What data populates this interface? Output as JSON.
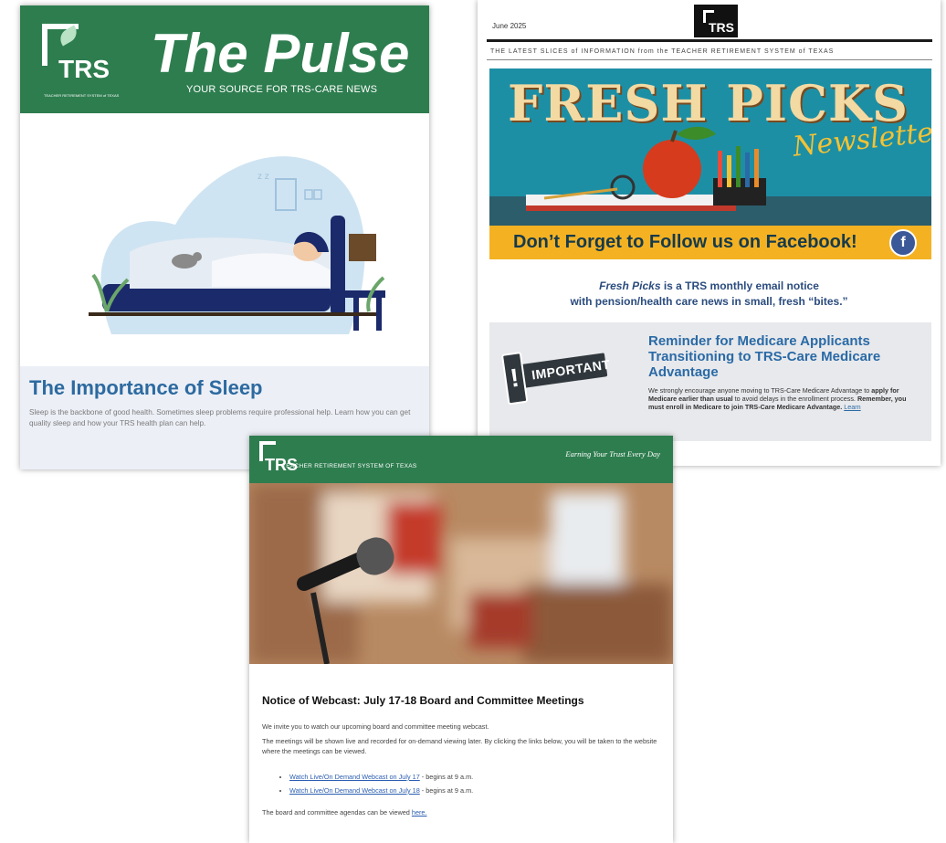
{
  "pulse": {
    "logo_text": "TRS",
    "logo_subtext": "TEACHER RETIREMENT SYSTEM of TEXAS",
    "title": "The Pulse",
    "subtitle": "YOUR SOURCE FOR TRS-CARE NEWS",
    "headline": "The Importance of Sleep",
    "body": "Sleep is the backbone of good health. Sometimes sleep problems require professional help. Learn how you can get quality sleep and how your TRS health plan can help."
  },
  "fresh": {
    "date": "June 2025",
    "logo_text": "TRS",
    "tagline": "THE LATEST SLICES of INFORMATION from the TEACHER RETIREMENT SYSTEM of TEXAS",
    "banner_title": "FRESH PICKS",
    "banner_sub": "Newsletter",
    "facebook_cta": "Don’t Forget to Follow us on Facebook!",
    "facebook_icon": "f",
    "intro_name": "Fresh Picks",
    "intro_rest": " is a TRS monthly email notice",
    "intro_line2": "with pension/health care news in small, fresh “bites.”",
    "badge_text": "IMPORTANT",
    "reminder_title": "Reminder for Medicare Applicants Transitioning to TRS-Care Medicare Advantage",
    "reminder_p1": "We strongly encourage anyone moving to TRS-Care Medicare Advantage to ",
    "reminder_b1": "apply for Medicare earlier than usual",
    "reminder_p2": " to avoid delays in the enrollment process. ",
    "reminder_b2": "Remember, you must enroll in Medicare to join TRS-Care Medicare Advantage.",
    "reminder_link": "Learn"
  },
  "webcast": {
    "logo_text": "TRS",
    "system_name": "TEACHER RETIREMENT SYSTEM OF TEXAS",
    "motto": "Earning Your Trust Every Day",
    "headline": "Notice of Webcast: July 17-18 Board and Committee Meetings",
    "p1": "We invite you to watch our upcoming board and committee meeting webcast.",
    "p2": "The meetings will be shown live and recorded for on-demand viewing later. By clicking the links below, you will be taken to the website where the meetings can be viewed.",
    "link1": "Watch Live/On Demand Webcast on July 17",
    "link1_rest": " - begins at 9 a.m.",
    "link2": "Watch Live/On Demand Webcast on July 18",
    "link2_rest": " - begins at 9 a.m.",
    "p3": "The board and committee agendas can be viewed ",
    "p3_link": "here."
  },
  "colors": {
    "trs_green": "#2e7d4f",
    "pulse_blue": "#2d6aa0",
    "banner_teal": "#1d8fa5",
    "facebook_yellow": "#f4b223"
  }
}
